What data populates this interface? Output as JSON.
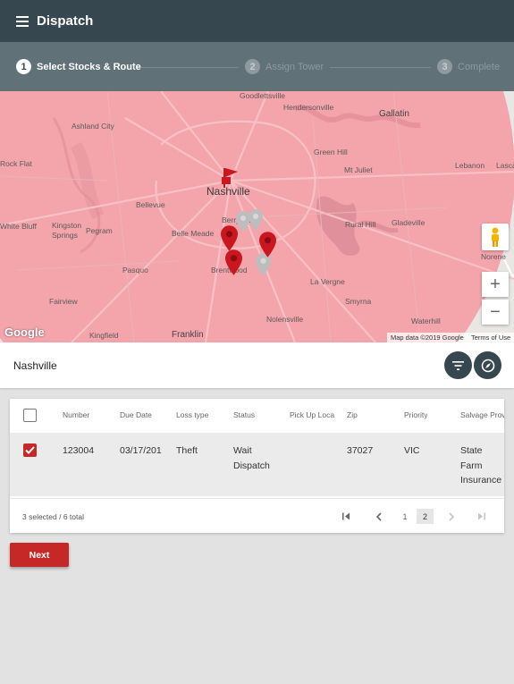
{
  "app": {
    "title": "Dispatch",
    "menu_icon": "menu-icon"
  },
  "stepper": {
    "steps": [
      {
        "number": "1",
        "label": "Select Stocks & Route",
        "active": true
      },
      {
        "number": "2",
        "label": "Assign Tower",
        "active": false
      },
      {
        "number": "3",
        "label": "Complete",
        "active": false
      }
    ]
  },
  "map": {
    "main_city": "Nashville",
    "labels": [
      "Goodlettsville",
      "Hendersonville",
      "Ashland City",
      "Gallatin",
      "Lascassas",
      "Green Hill",
      "Mt Juliet",
      "Lebanon",
      "Kingston Springs",
      "Pegram",
      "White Bluff",
      "Bellevue",
      "Belle Meade",
      "Rural Hill",
      "Gladeville",
      "Norene",
      "Pasquo",
      "Brentwood",
      "La Vergne",
      "Fairview",
      "Smyrna",
      "Nolensville",
      "Waterhill",
      "Kingfield",
      "Franklin",
      "Rock Flat",
      "Berry Hill"
    ],
    "google_logo": "Google",
    "attribution": "Map data ©2019 Google",
    "terms": "Terms of Use",
    "zoom_in": "+",
    "zoom_out": "−",
    "overlay_color": "#f4a4ab",
    "pin_color": "#c9161f",
    "pin_color_muted": "#bdbdbd"
  },
  "search": {
    "value": "Nashville",
    "filter_icon": "filter-icon",
    "compass_icon": "compass-icon"
  },
  "table": {
    "columns": [
      "Number",
      "Due Date",
      "Loss type",
      "Status",
      "Pick Up Loca",
      "Zip",
      "Priority",
      "Salvage Prov"
    ],
    "rows": [
      {
        "checked": true,
        "number": "123004",
        "due_date": "03/17/201",
        "loss_type": "Theft",
        "status_line1": "Wait",
        "status_line2": "Dispatch",
        "pickup": "",
        "zip": "37027",
        "priority": "VIC",
        "salvage_line1": "State",
        "salvage_line2": "Farm",
        "salvage_line3": "Insurance"
      }
    ],
    "footer": {
      "selected_text": "3 selected / 6 total",
      "pages": [
        "1",
        "2"
      ],
      "current_page": "2"
    }
  },
  "actions": {
    "next_label": "Next"
  },
  "colors": {
    "appbar": "#37474f",
    "stepper": "#607177",
    "accent": "#c62828"
  }
}
